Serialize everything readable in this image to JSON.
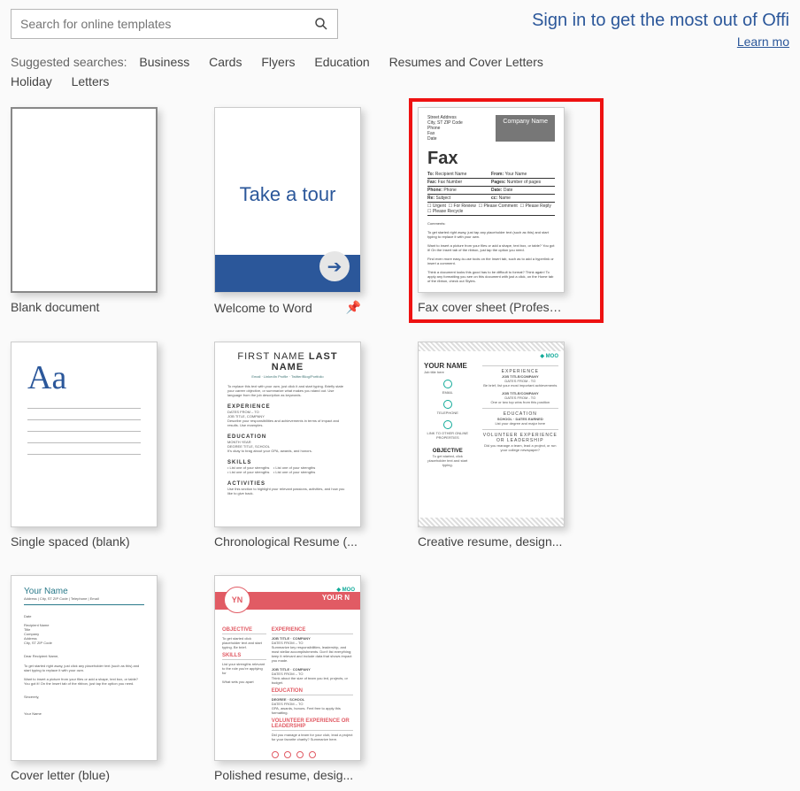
{
  "search": {
    "placeholder": "Search for online templates"
  },
  "signin": {
    "text": "Sign in to get the most out of Offi",
    "learn": "Learn mo"
  },
  "suggested": {
    "label": "Suggested searches:",
    "links": [
      "Business",
      "Cards",
      "Flyers",
      "Education",
      "Resumes and Cover Letters",
      "Holiday",
      "Letters"
    ]
  },
  "templates": [
    {
      "label": "Blank document"
    },
    {
      "label": "Welcome to Word",
      "tour": "Take a tour"
    },
    {
      "label": "Fax cover sheet (Profess...",
      "fax_title": "Fax",
      "company": "Company Name"
    },
    {
      "label": "Single spaced (blank)",
      "aa": "Aa"
    },
    {
      "label": "Chronological Resume (...",
      "name_first": "FIRST NAME",
      "name_last": "LAST NAME",
      "sections": [
        "EXPERIENCE",
        "EDUCATION",
        "SKILLS",
        "ACTIVITIES"
      ]
    },
    {
      "label": "Creative resume, design...",
      "name": "YOUR NAME",
      "moo": "MOO",
      "right": [
        "EXPERIENCE",
        "EDUCATION",
        "VOLUNTEER EXPERIENCE OR LEADERSHIP"
      ]
    },
    {
      "label": "Cover letter (blue)",
      "name": "Your Name",
      "recip": "Dear Recipient Name,"
    },
    {
      "label": "Polished resume, desig...",
      "initials": "YN",
      "name": "YOUR N",
      "moo": "MOO",
      "left": [
        "OBJECTIVE",
        "SKILLS"
      ],
      "right": [
        "EXPERIENCE",
        "EDUCATION",
        "VOLUNTEER EXPERIENCE OR LEADERSHIP"
      ]
    }
  ]
}
